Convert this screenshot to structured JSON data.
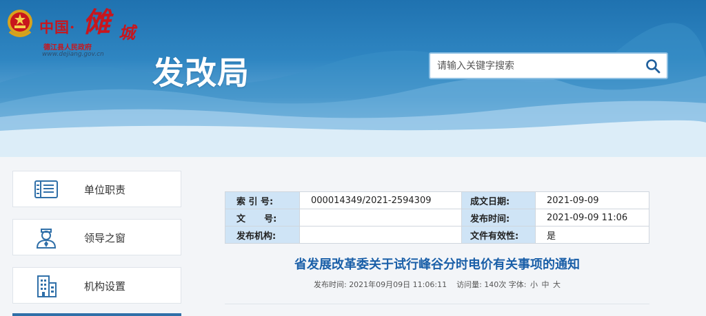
{
  "header": {
    "logo": {
      "prefix": "中国·",
      "main": "傩",
      "suffix": "城",
      "subtitle": "德江县人民政府",
      "url": "www.dejiang.gov.cn"
    },
    "site_title": "发改局",
    "search": {
      "placeholder": "请输入关键字搜索",
      "icon": "search-icon"
    }
  },
  "sidebar": {
    "items": [
      {
        "label": "单位职责",
        "icon": "document-list-icon"
      },
      {
        "label": "领导之窗",
        "icon": "person-icon"
      },
      {
        "label": "机构设置",
        "icon": "building-icon"
      }
    ]
  },
  "meta": {
    "index_label": "索 引 号:",
    "index_value": "000014349/2021-2594309",
    "date_label": "成文日期:",
    "date_value": "2021-09-09",
    "docno_label": "文      号:",
    "docno_value": "",
    "pubtime_label": "发布时间:",
    "pubtime_value": "2021-09-09 11:06",
    "org_label": "发布机构:",
    "org_value": "",
    "valid_label": "文件有效性:",
    "valid_value": "是"
  },
  "article": {
    "title": "省发展改革委关于试行峰谷分时电价有关事项的通知",
    "pub_label": "发布时间:",
    "pub_value": "2021年09月09日 11:06:11",
    "visits_label": "访问量:",
    "visits_value": "140次",
    "font_label": "字体:",
    "font_small": "小",
    "font_medium": "中",
    "font_large": "大"
  },
  "colors": {
    "brand_red": "#c8161d",
    "header_blue": "#2f86c2",
    "title_blue": "#1a5fa8",
    "table_key_bg": "#cfe4f6"
  }
}
